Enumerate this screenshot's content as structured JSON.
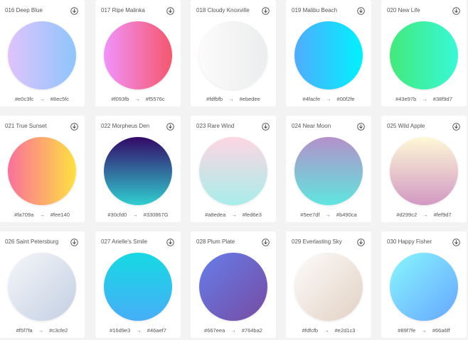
{
  "gradients": [
    {
      "title": "016 Deep Blue",
      "from": "#e0c3fc",
      "to": "#8ec5fc",
      "direction": "to right"
    },
    {
      "title": "017 Ripe Malinka",
      "from": "#f093fb",
      "to": "#f5576c",
      "direction": "to right"
    },
    {
      "title": "018 Cloudy Knoxville",
      "from": "#fdfbfb",
      "to": "#ebedee",
      "direction": "to right"
    },
    {
      "title": "019 Malibu Beach",
      "from": "#4facfe",
      "to": "#00f2fe",
      "direction": "to right"
    },
    {
      "title": "020 New Life",
      "from": "#43e97b",
      "to": "#38f9d7",
      "direction": "to right"
    },
    {
      "title": "021 True Sunset",
      "from": "#fa709a",
      "to": "#fee140",
      "direction": "to right"
    },
    {
      "title": "022 Morpheus Den",
      "from": "#30cfd0",
      "to": "#330867",
      "direction": "to top",
      "from_label": "#30cfd0",
      "to_label": "#330867G"
    },
    {
      "title": "023 Rare Wind",
      "from": "#a8edea",
      "to": "#fed6e3",
      "direction": "to top"
    },
    {
      "title": "024 Near Moon",
      "from": "#5ee7df",
      "to": "#b490ca",
      "direction": "to top"
    },
    {
      "title": "025 Wild Apple",
      "from": "#d299c2",
      "to": "#fef9d7",
      "direction": "to top"
    },
    {
      "title": "026 Saint Petersburg",
      "from": "#f5f7fa",
      "to": "#c3cfe2",
      "direction": "135deg"
    },
    {
      "title": "027 Arielle's Smile",
      "from": "#16d9e3",
      "to": "#46aef7",
      "direction": "to bottom"
    },
    {
      "title": "028 Plum Plate",
      "from": "#667eea",
      "to": "#764ba2",
      "direction": "135deg"
    },
    {
      "title": "029 Everlasting Sky",
      "from": "#fdfcfb",
      "to": "#e2d1c3",
      "direction": "135deg"
    },
    {
      "title": "030 Happy Fisher",
      "from": "#89f7fe",
      "to": "#66a6ff",
      "direction": "135deg"
    }
  ],
  "arrow": "→",
  "icon": "download-icon"
}
